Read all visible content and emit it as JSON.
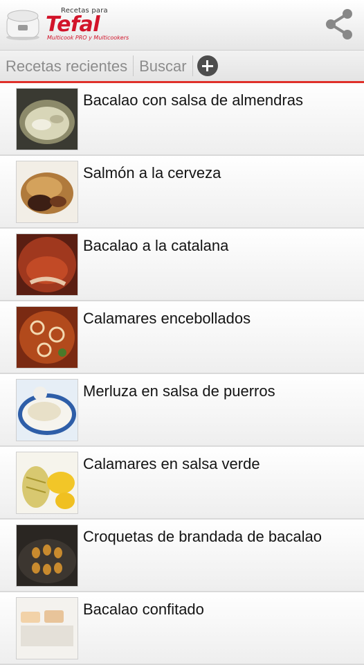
{
  "header": {
    "brand_tagline": "Recetas para",
    "brand_name": "Tefal",
    "brand_sub": "Multicook PRO y Multicookers",
    "share_icon": "share-icon"
  },
  "tabs": [
    {
      "label": "Recetas recientes"
    },
    {
      "label": "Buscar"
    }
  ],
  "colors": {
    "accent": "#e0302a",
    "brand": "#d2142a"
  },
  "recipes": [
    {
      "title": "Bacalao con salsa de almendras"
    },
    {
      "title": "Salmón a la cerveza"
    },
    {
      "title": "Bacalao a la catalana"
    },
    {
      "title": "Calamares encebollados"
    },
    {
      "title": "Merluza en salsa de puerros"
    },
    {
      "title": "Calamares en salsa verde"
    },
    {
      "title": "Croquetas de brandada de bacalao"
    },
    {
      "title": "Bacalao confitado"
    }
  ]
}
